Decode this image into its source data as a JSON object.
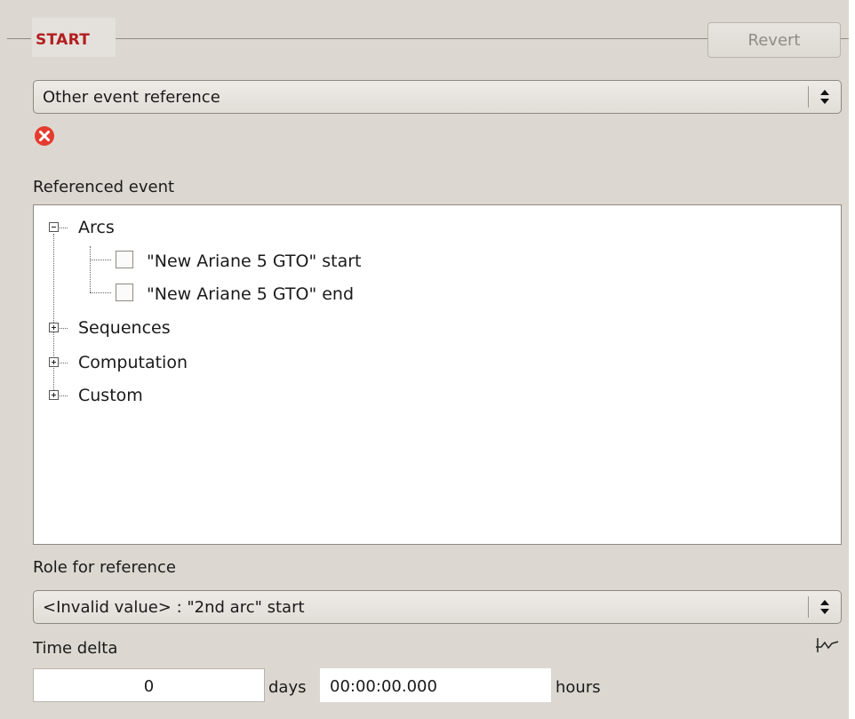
{
  "group": {
    "title": "START",
    "revert_label": "Revert"
  },
  "reference_combo": {
    "selected": "Other event reference"
  },
  "status": {
    "icon": "error-icon",
    "color": "#e53b2f"
  },
  "referenced_event": {
    "label": "Referenced event",
    "tree": [
      {
        "label": "Arcs",
        "expanded": true,
        "children": [
          {
            "label": "\"New Ariane 5 GTO\" start",
            "checked": false
          },
          {
            "label": "\"New Ariane 5 GTO\" end",
            "checked": false
          }
        ]
      },
      {
        "label": "Sequences",
        "expanded": false
      },
      {
        "label": "Computation",
        "expanded": false
      },
      {
        "label": "Custom",
        "expanded": false
      }
    ]
  },
  "role": {
    "label": "Role for reference",
    "selected": "<Invalid value> : \"2nd arc\" start"
  },
  "time_delta": {
    "label": "Time delta",
    "days_value": "0",
    "days_unit": "days",
    "hours_value": "00:00:00.000",
    "hours_unit": "hours",
    "graph_icon": "graph-icon"
  },
  "colors": {
    "panel_bg": "#dcd8d1",
    "title_red": "#b21e20",
    "error_red": "#e53b2f"
  }
}
